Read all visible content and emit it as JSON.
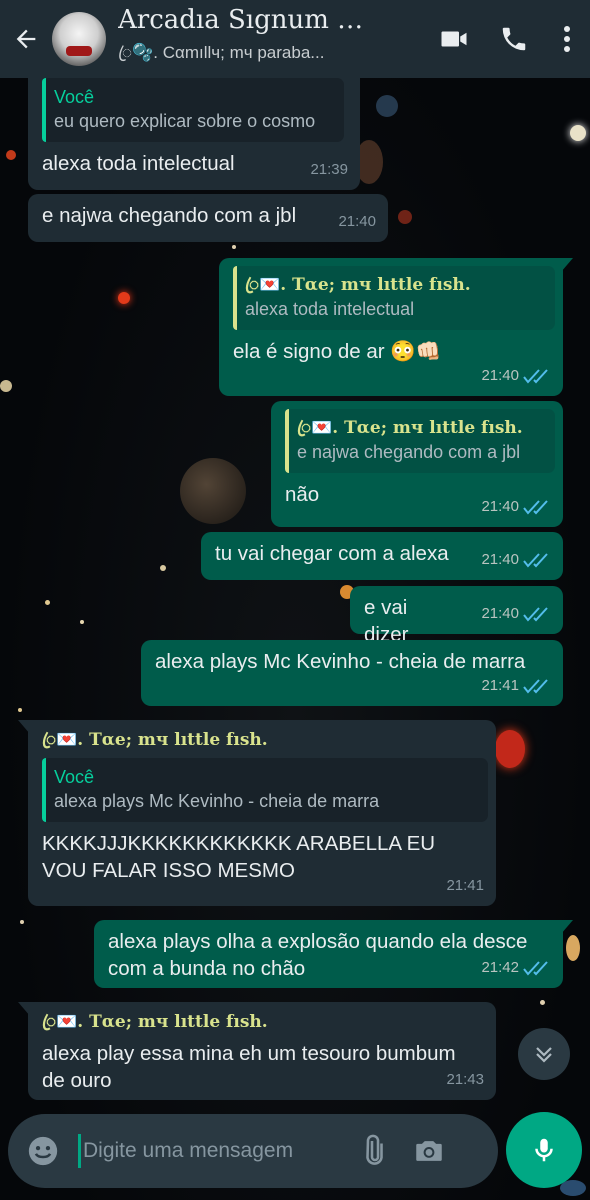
{
  "header": {
    "title": "Arcadıa Sıgnum -...",
    "subtitle": "ꦿ🫧. Cαmıllч; mч paraba..."
  },
  "messages": [
    {
      "quote_author": "Você",
      "quote_text": "eu quero explicar sobre o cosmo",
      "text": "alexa toda intelectual",
      "time": "21:39"
    },
    {
      "text": "e najwa chegando com a jbl",
      "time": "21:40"
    },
    {
      "quote_author": "ꦿ💌. Tαe; mч lıttle fısh.",
      "quote_text": "alexa toda intelectual",
      "text": "ela é signo de ar 😳👊🏻",
      "time": "21:40"
    },
    {
      "quote_author": "ꦿ💌. Tαe; mч lıttle fısh.",
      "quote_text": "e najwa chegando com a jbl",
      "text": "não",
      "time": "21:40"
    },
    {
      "text": "tu vai chegar com a alexa",
      "time": "21:40"
    },
    {
      "text": "e vai dizer",
      "time": "21:40"
    },
    {
      "text": "alexa plays Mc Kevinho - cheia de marra",
      "time": "21:41"
    },
    {
      "sender": "ꦿ💌. Tαe; mч lıttle fısh.",
      "quote_author": "Você",
      "quote_text": "alexa plays Mc Kevinho - cheia de marra",
      "text": "KKKKJJJKKKKKKKKKKKK ARABELLA EU VOU FALAR ISSO MESMO",
      "time": "21:41"
    },
    {
      "text": "alexa plays olha a explosão quando ela desce com a bunda no chão",
      "time": "21:42"
    },
    {
      "sender": "ꦿ💌. Tαe; mч lıttle fısh.",
      "text": "alexa play essa mina eh um tesouro bumbum de ouro",
      "time": "21:43"
    }
  ],
  "composer": {
    "placeholder": "Digite uma mensagem"
  },
  "colors": {
    "header": "#1f2c34",
    "incoming": "#1f2c34",
    "outgoing": "#005c4b",
    "accent": "#00a884",
    "read_ticks": "#53bdeb"
  },
  "icons": [
    "back-arrow-icon",
    "video-call-icon",
    "phone-icon",
    "more-options-icon",
    "double-check-icon",
    "chevron-double-down-icon",
    "emoji-icon",
    "paperclip-icon",
    "camera-icon",
    "microphone-icon"
  ]
}
